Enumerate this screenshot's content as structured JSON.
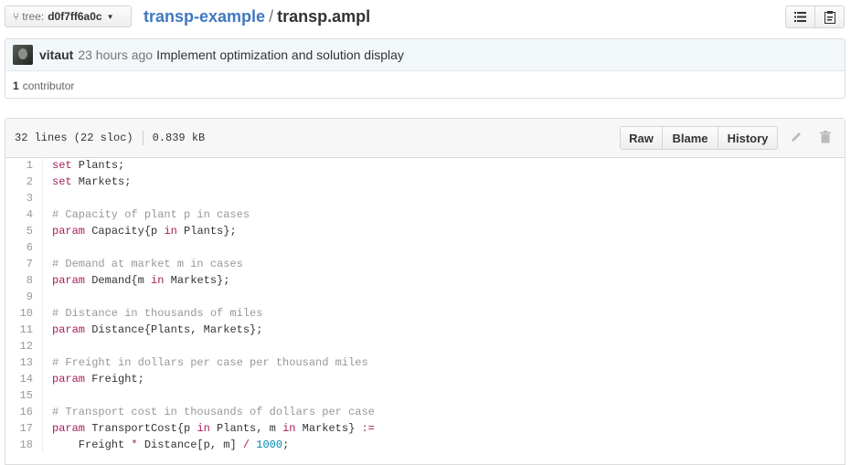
{
  "branch": {
    "tree_label": "tree:",
    "sha": "d0f7ff6a0c"
  },
  "breadcrumb": {
    "repo": "transp-example",
    "separator": "/",
    "file": "transp.ampl"
  },
  "commit": {
    "author": "vitaut",
    "time": "23 hours ago",
    "message": "Implement optimization and solution display"
  },
  "contributors": {
    "count": "1",
    "label": "contributor"
  },
  "file": {
    "lines_info": "32 lines (22 sloc)",
    "size": "0.839 kB",
    "raw_label": "Raw",
    "blame_label": "Blame",
    "history_label": "History"
  },
  "icons": {
    "branch": "git-branch-icon",
    "list": "list-icon",
    "clipboard": "clipboard-icon",
    "pencil": "pencil-icon",
    "trash": "trash-icon"
  },
  "colors": {
    "link": "#4078c0",
    "keyword": "#a71d5d",
    "comment": "#969896",
    "number": "#0086b3"
  },
  "code_lines": [
    [
      {
        "t": "set",
        "s": "k"
      },
      {
        "t": " Plants;",
        "s": ""
      }
    ],
    [
      {
        "t": "set",
        "s": "k"
      },
      {
        "t": " Markets;",
        "s": ""
      }
    ],
    [],
    [
      {
        "t": "# Capacity of plant p in cases",
        "s": "c"
      }
    ],
    [
      {
        "t": "param",
        "s": "k"
      },
      {
        "t": " Capacity{p ",
        "s": ""
      },
      {
        "t": "in",
        "s": "k"
      },
      {
        "t": " Plants};",
        "s": ""
      }
    ],
    [],
    [
      {
        "t": "# Demand at market m in cases",
        "s": "c"
      }
    ],
    [
      {
        "t": "param",
        "s": "k"
      },
      {
        "t": " Demand{m ",
        "s": ""
      },
      {
        "t": "in",
        "s": "k"
      },
      {
        "t": " Markets};",
        "s": ""
      }
    ],
    [],
    [
      {
        "t": "# Distance in thousands of miles",
        "s": "c"
      }
    ],
    [
      {
        "t": "param",
        "s": "k"
      },
      {
        "t": " Distance{Plants, Markets};",
        "s": ""
      }
    ],
    [],
    [
      {
        "t": "# Freight in dollars per case per thousand miles",
        "s": "c"
      }
    ],
    [
      {
        "t": "param",
        "s": "k"
      },
      {
        "t": " Freight;",
        "s": ""
      }
    ],
    [],
    [
      {
        "t": "# Transport cost in thousands of dollars per case",
        "s": "c"
      }
    ],
    [
      {
        "t": "param",
        "s": "k"
      },
      {
        "t": " TransportCost{p ",
        "s": ""
      },
      {
        "t": "in",
        "s": "k"
      },
      {
        "t": " Plants, m ",
        "s": ""
      },
      {
        "t": "in",
        "s": "k"
      },
      {
        "t": " Markets} ",
        "s": ""
      },
      {
        "t": ":=",
        "s": "k"
      }
    ],
    [
      {
        "t": "    Freight ",
        "s": ""
      },
      {
        "t": "*",
        "s": "k"
      },
      {
        "t": " Distance[p, m] ",
        "s": ""
      },
      {
        "t": "/",
        "s": "k"
      },
      {
        "t": " ",
        "s": ""
      },
      {
        "t": "1000",
        "s": "n"
      },
      {
        "t": ";",
        "s": ""
      }
    ]
  ]
}
